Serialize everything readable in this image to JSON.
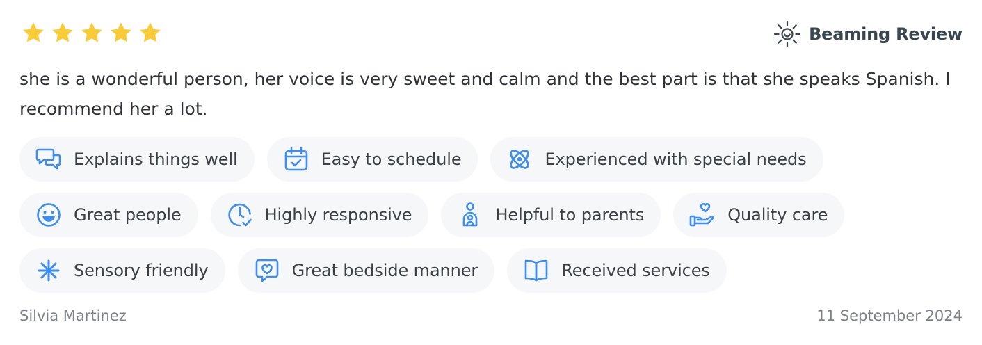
{
  "rating": {
    "stars": 5,
    "max": 5,
    "star_color": "#f9cb36"
  },
  "badge": {
    "label": "Beaming Review",
    "icon": "sun-icon"
  },
  "review": {
    "text": "she is a wonderful person, her voice is very sweet and calm and the best part is that she speaks Spanish. I recommend her a lot."
  },
  "tags": [
    {
      "label": "Explains things well",
      "icon": "chat-bubbles-icon"
    },
    {
      "label": "Easy to schedule",
      "icon": "calendar-check-icon"
    },
    {
      "label": "Experienced with special needs",
      "icon": "atom-icon"
    },
    {
      "label": "Great people",
      "icon": "smiley-icon"
    },
    {
      "label": "Highly responsive",
      "icon": "clock-check-icon"
    },
    {
      "label": "Helpful to parents",
      "icon": "parent-child-icon"
    },
    {
      "label": "Quality care",
      "icon": "heart-hand-icon"
    },
    {
      "label": "Sensory friendly",
      "icon": "asterisk-icon"
    },
    {
      "label": "Great bedside manner",
      "icon": "heart-speech-icon"
    },
    {
      "label": "Received services",
      "icon": "open-book-icon"
    }
  ],
  "icon_color": "#3d8ef0",
  "footer": {
    "reviewer": "Silvia Martinez",
    "date": "11 September 2024"
  }
}
